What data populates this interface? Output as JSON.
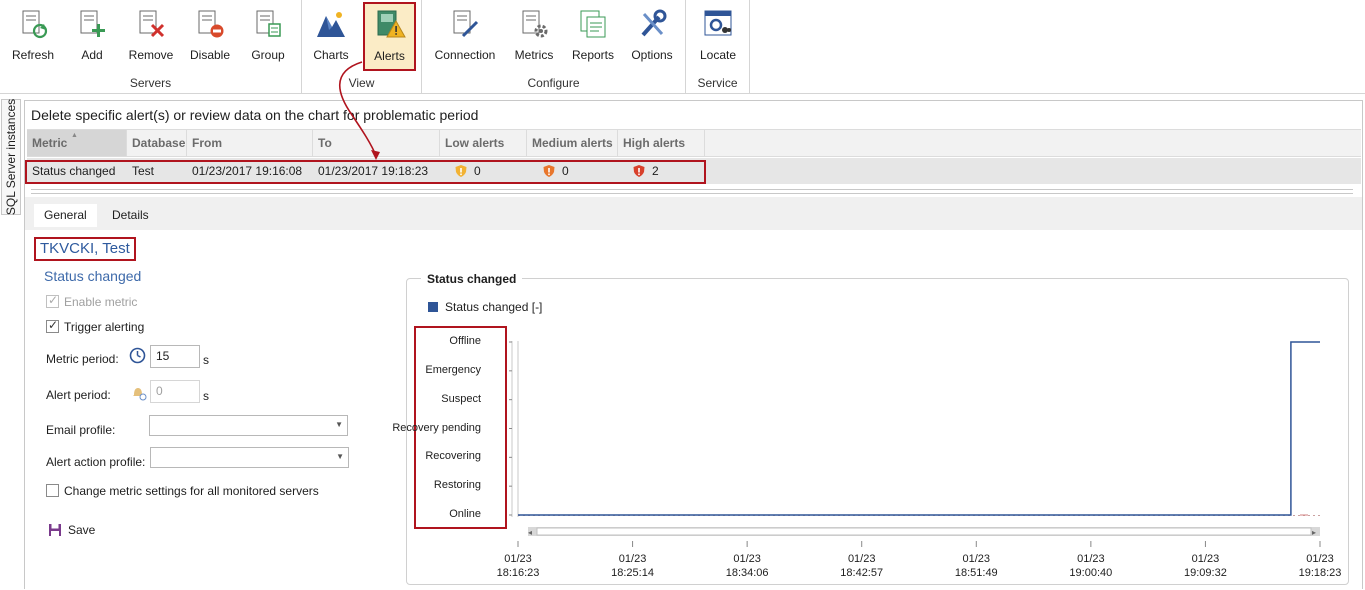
{
  "ribbon": {
    "groups": [
      {
        "name": "Servers",
        "buttons": [
          {
            "label": "Refresh",
            "icon": "refresh-icon"
          },
          {
            "label": "Add",
            "icon": "add-server-icon"
          },
          {
            "label": "Remove",
            "icon": "remove-server-icon"
          },
          {
            "label": "Disable",
            "icon": "disable-server-icon"
          },
          {
            "label": "Group",
            "icon": "group-server-icon"
          }
        ]
      },
      {
        "name": "View",
        "buttons": [
          {
            "label": "Charts",
            "icon": "charts-icon"
          },
          {
            "label": "Alerts",
            "icon": "alerts-icon",
            "active": true
          }
        ]
      },
      {
        "name": "Configure",
        "buttons": [
          {
            "label": "Connection",
            "icon": "connection-icon"
          },
          {
            "label": "Metrics",
            "icon": "metrics-icon"
          },
          {
            "label": "Reports",
            "icon": "reports-icon"
          },
          {
            "label": "Options",
            "icon": "options-icon"
          }
        ]
      },
      {
        "name": "Service",
        "buttons": [
          {
            "label": "Locate",
            "icon": "locate-icon"
          }
        ]
      }
    ]
  },
  "sidetab": {
    "label": "SQL Server instances"
  },
  "panel": {
    "instruction": "Delete specific alert(s) or review data on the chart for problematic period",
    "columns": {
      "metric": "Metric",
      "database": "Database",
      "from": "From",
      "to": "To",
      "low": "Low alerts",
      "medium": "Medium alerts",
      "high": "High alerts"
    },
    "row": {
      "metric": "Status changed",
      "database": "Test",
      "from": "01/23/2017 19:16:08",
      "to": "01/23/2017 19:18:23",
      "low": "0",
      "medium": "0",
      "high": "2"
    }
  },
  "tabs": {
    "general": "General",
    "details": "Details"
  },
  "detail": {
    "title": "TKVCKI, Test",
    "subtitle": "Status changed",
    "enable_metric": "Enable metric",
    "trigger_alerting": "Trigger alerting",
    "metric_period_label": "Metric period:",
    "metric_period_value": "15",
    "metric_period_unit": "s",
    "alert_period_label": "Alert period:",
    "alert_period_value": "0",
    "alert_period_unit": "s",
    "email_profile_label": "Email profile:",
    "email_profile_value": "",
    "alert_action_label": "Alert action profile:",
    "alert_action_value": "",
    "change_all_label": "Change metric settings for all monitored servers",
    "save_label": "Save"
  },
  "colors": {
    "accent_red": "#b0141e",
    "series_blue": "#2f5597",
    "title_blue": "#2e5a9e"
  },
  "chart_data": {
    "type": "line",
    "title": "Status changed",
    "legend": [
      "Status changed [-]"
    ],
    "legend_placement": "top-left",
    "y_categories": [
      "Online",
      "Restoring",
      "Recovering",
      "Recovery pending",
      "Suspect",
      "Emergency",
      "Offline"
    ],
    "x_ticks": [
      [
        "01/23",
        "18:16:23"
      ],
      [
        "01/23",
        "18:25:14"
      ],
      [
        "01/23",
        "18:34:06"
      ],
      [
        "01/23",
        "18:42:57"
      ],
      [
        "01/23",
        "18:51:49"
      ],
      [
        "01/23",
        "19:00:40"
      ],
      [
        "01/23",
        "19:09:32"
      ],
      [
        "01/23",
        "19:18:23"
      ]
    ],
    "x_range": [
      "01/23 18:16:23",
      "01/23 19:18:23"
    ],
    "series": [
      {
        "name": "Status changed [-]",
        "points": [
          {
            "t": "18:16:23",
            "state": "Online"
          },
          {
            "t": "19:16:08",
            "state": "Online"
          },
          {
            "t": "19:16:08",
            "state": "Offline"
          },
          {
            "t": "19:18:23",
            "state": "Offline"
          }
        ]
      }
    ],
    "grid": false
  }
}
